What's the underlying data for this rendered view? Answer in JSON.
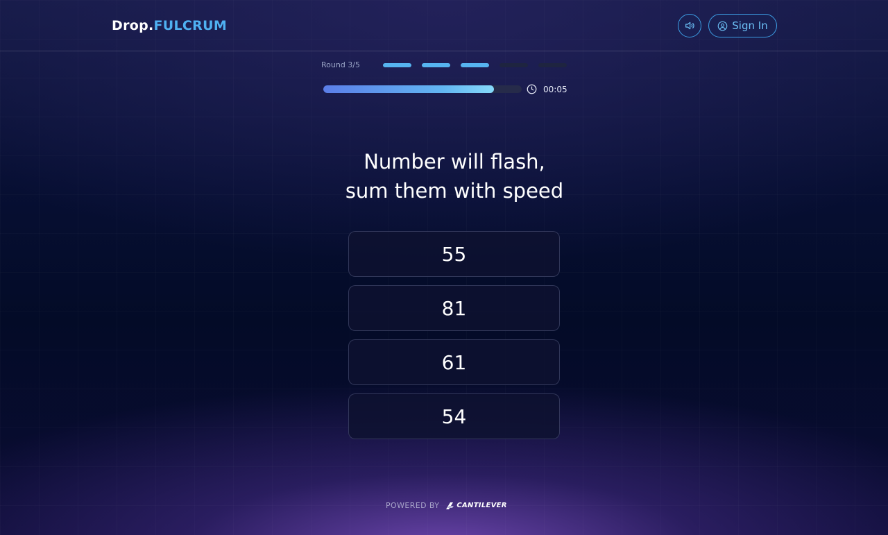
{
  "header": {
    "logo_left": "Drop.",
    "logo_right": "FULCRUM",
    "sound_icon": "speaker-icon",
    "signin_label": "Sign In",
    "signin_icon": "user-circle-icon"
  },
  "progress": {
    "round_label": "Round 3/5",
    "rounds_total": 5,
    "rounds_completed": 3,
    "timer_fraction": 0.86,
    "timer_text": "00:05",
    "clock_icon": "clock-icon"
  },
  "question": {
    "line1": "Number will flash,",
    "line2": "sum them with speed"
  },
  "options": [
    "55",
    "81",
    "61",
    "54"
  ],
  "footer": {
    "powered_by": "POWERED BY",
    "brand": "CANTILEVER"
  },
  "colors": {
    "accent": "#4fb1f2",
    "segment_active": "#56b4f0",
    "segment_inactive": "#1e2440",
    "background": "#030a24"
  }
}
